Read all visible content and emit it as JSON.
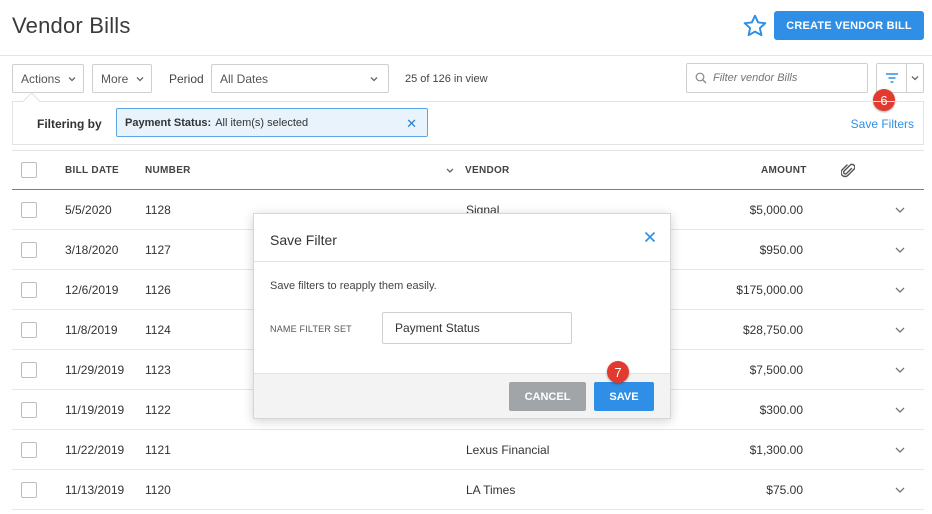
{
  "header": {
    "title": "Vendor Bills",
    "create_label": "CREATE VENDOR BILL"
  },
  "toolbar": {
    "actions_label": "Actions",
    "more_label": "More",
    "period_label": "Period",
    "period_value": "All Dates",
    "in_view": "25 of 126 in view",
    "search_placeholder": "Filter vendor Bills"
  },
  "filter": {
    "filtering_by_label": "Filtering by",
    "chip_key": "Payment Status:",
    "chip_value": "All item(s) selected",
    "save_filters_label": "Save Filters"
  },
  "badges": {
    "step6": "6",
    "step7": "7"
  },
  "table": {
    "columns": {
      "bill_date": "BILL DATE",
      "number": "NUMBER",
      "vendor": "VENDOR",
      "amount": "AMOUNT"
    },
    "rows": [
      {
        "date": "5/5/2020",
        "number": "1128",
        "vendor": "Signal",
        "amount": "$5,000.00"
      },
      {
        "date": "3/18/2020",
        "number": "1127",
        "vendor": "",
        "amount": "$950.00"
      },
      {
        "date": "12/6/2019",
        "number": "1126",
        "vendor": "",
        "amount": "$175,000.00"
      },
      {
        "date": "11/8/2019",
        "number": "1124",
        "vendor": "",
        "amount": "$28,750.00"
      },
      {
        "date": "11/29/2019",
        "number": "1123",
        "vendor": "",
        "amount": "$7,500.00"
      },
      {
        "date": "11/19/2019",
        "number": "1122",
        "vendor": "",
        "amount": "$300.00"
      },
      {
        "date": "11/22/2019",
        "number": "1121",
        "vendor": "Lexus Financial",
        "amount": "$1,300.00"
      },
      {
        "date": "11/13/2019",
        "number": "1120",
        "vendor": "LA Times",
        "amount": "$75.00"
      }
    ]
  },
  "modal": {
    "title": "Save Filter",
    "description": "Save filters to reapply them easily.",
    "name_label": "NAME FILTER SET",
    "name_value": "Payment Status",
    "cancel_label": "CANCEL",
    "save_label": "SAVE"
  },
  "colors": {
    "accent": "#2f8fe6",
    "badge": "#e23a2e",
    "cancel": "#a2a5a8"
  }
}
